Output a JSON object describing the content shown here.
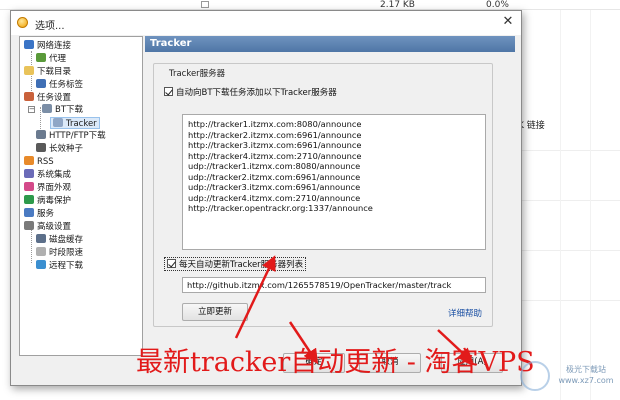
{
  "background": {
    "file_size": "2.17 KB",
    "percent": "0.0%",
    "side_text": "K 链接"
  },
  "dialog": {
    "title": "选项...",
    "close_glyph": "✕"
  },
  "tree": {
    "items": [
      {
        "label": "网络连接",
        "icon": "network-icon"
      },
      {
        "label": "代理",
        "icon": "proxy-icon"
      },
      {
        "label": "下载目录",
        "icon": "folder-icon"
      },
      {
        "label": "任务标签",
        "icon": "tag-icon"
      },
      {
        "label": "任务设置",
        "icon": "task-settings-icon"
      },
      {
        "label": "BT下载",
        "icon": "bt-icon"
      },
      {
        "label": "Tracker",
        "icon": "tracker-icon"
      },
      {
        "label": "HTTP/FTP下载",
        "icon": "http-icon"
      },
      {
        "label": "长效种子",
        "icon": "seed-icon"
      },
      {
        "label": "RSS",
        "icon": "rss-icon"
      },
      {
        "label": "系统集成",
        "icon": "system-icon"
      },
      {
        "label": "界面外观",
        "icon": "appearance-icon"
      },
      {
        "label": "病毒保护",
        "icon": "shield-icon"
      },
      {
        "label": "服务",
        "icon": "service-icon"
      },
      {
        "label": "高级设置",
        "icon": "advanced-icon"
      },
      {
        "label": "磁盘缓存",
        "icon": "disk-icon"
      },
      {
        "label": "时段限速",
        "icon": "schedule-icon"
      },
      {
        "label": "远程下载",
        "icon": "remote-icon"
      }
    ]
  },
  "panel": {
    "header": "Tracker",
    "group_title": "Tracker服务器",
    "auto_add_label": "自动向BT下载任务添加以下Tracker服务器",
    "trackers": [
      "http://tracker1.itzmx.com:8080/announce",
      "http://tracker2.itzmx.com:6961/announce",
      "http://tracker3.itzmx.com:6961/announce",
      "http://tracker4.itzmx.com:2710/announce",
      "udp://tracker1.itzmx.com:8080/announce",
      "udp://tracker2.itzmx.com:6961/announce",
      "udp://tracker3.itzmx.com:6961/announce",
      "udp://tracker4.itzmx.com:2710/announce",
      "http://tracker.opentrackr.org:1337/announce"
    ],
    "daily_update_label": "每天自动更新Tracker服务器列表",
    "update_url": "http://github.itzmx.com/1265578519/OpenTracker/master/track",
    "update_now_label": "立即更新",
    "help_link": "详细帮助"
  },
  "footer": {
    "ok_label": "确定",
    "cancel_label": "取消",
    "apply_label": "应用(A)"
  },
  "annotation": {
    "caption": "最新tracker自动更新 - 淘客VPS",
    "watermark_line1": "极光下载站",
    "watermark_line2": "www.xz7.com",
    "accent_color": "#e21a1a"
  }
}
